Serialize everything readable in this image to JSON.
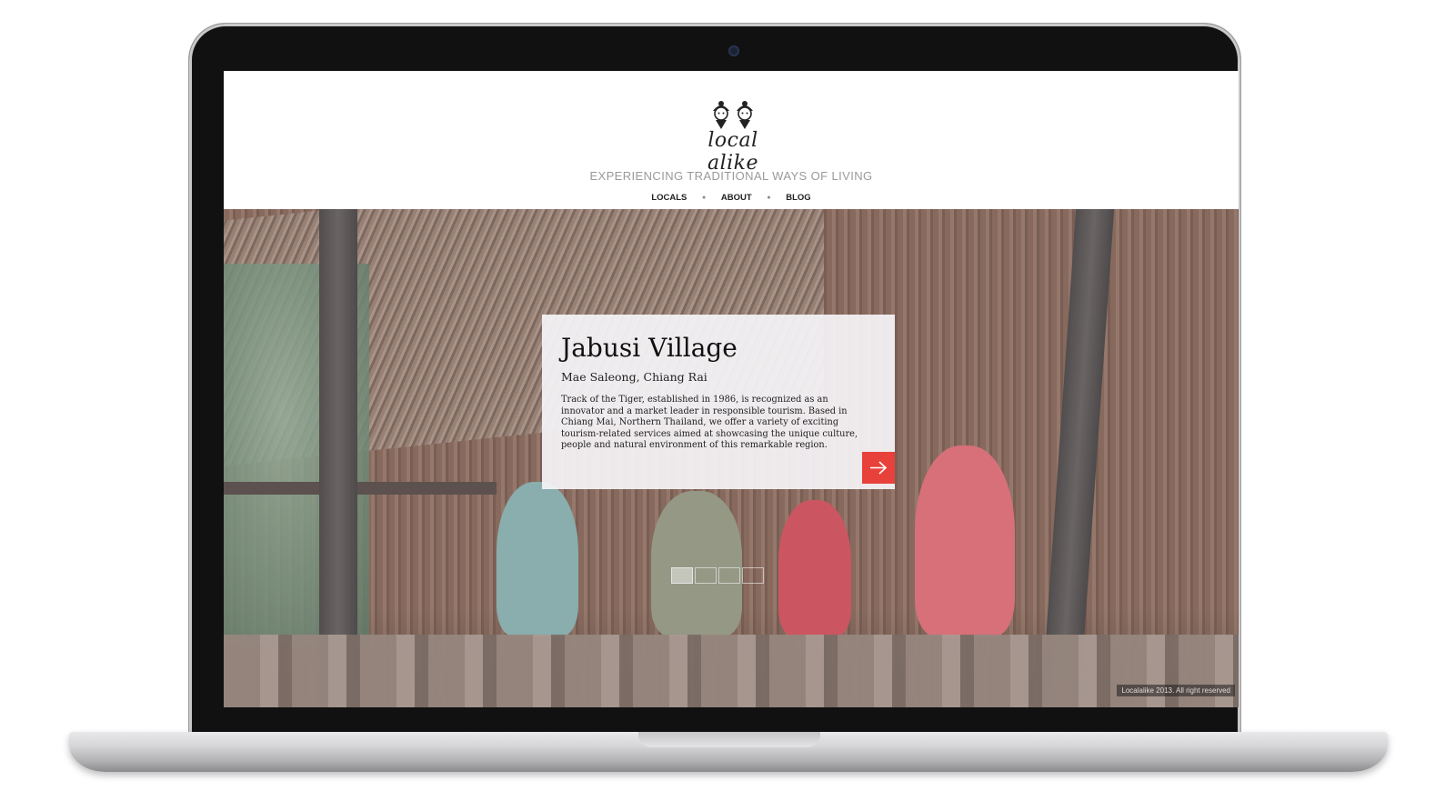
{
  "site": {
    "logo_text": "local alike",
    "tagline": "EXPERIENCING TRADITIONAL WAYS OF LIVING",
    "nav": [
      "LOCALS",
      "ABOUT",
      "BLOG"
    ]
  },
  "hero": {
    "title": "Jabusi Village",
    "subtitle": "Mae Saleong, Chiang Rai",
    "body": "Track of the Tiger, established in 1986, is recognized as an innovator and a market leader in responsible tourism. Based in Chiang Mai, Northern Thailand, we offer a variety of exciting tourism-related services aimed at showcasing the unique culture, people and natural environment of this remarkable region.",
    "arrow_icon": "arrow-right-icon",
    "slides_total": 4,
    "slide_active": 1
  },
  "footer": {
    "copyright": "Localalike 2013. All right reserved"
  },
  "colors": {
    "accent": "#e8413b",
    "tagline": "#9a9a9a",
    "card_bg": "#f5f4f8"
  }
}
